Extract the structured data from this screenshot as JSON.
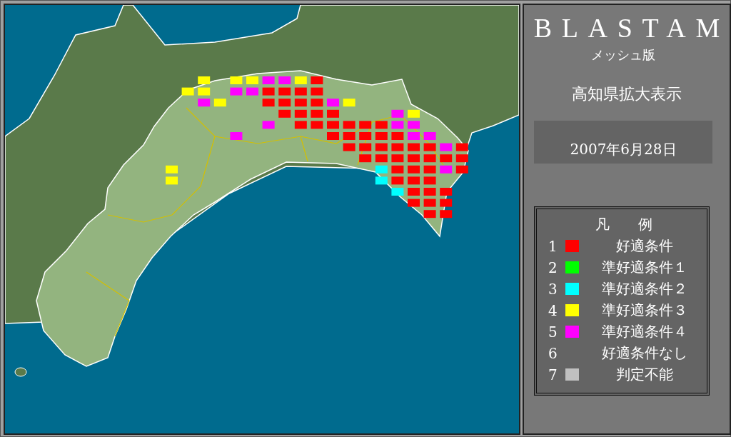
{
  "map": {
    "mesh_rows": [
      {
        "cells": [
          {
            "kind": "blank"
          },
          {
            "kind": "blank"
          },
          {
            "kind": "mesh",
            "color": "#ffff00"
          },
          {
            "kind": "blank"
          },
          {
            "kind": "mesh",
            "color": "#ffff00"
          },
          {
            "kind": "mesh",
            "color": "#ffff00"
          },
          {
            "kind": "mesh",
            "color": "#ff00ff"
          },
          {
            "kind": "mesh",
            "color": "#ff00ff"
          },
          {
            "kind": "mesh",
            "color": "#ffff00"
          },
          {
            "kind": "mesh",
            "color": "#ff0000"
          }
        ]
      },
      {
        "cells": [
          {
            "kind": "blank"
          },
          {
            "kind": "mesh",
            "color": "#ffff00"
          },
          {
            "kind": "mesh",
            "color": "#ffff00"
          },
          {
            "kind": "blank"
          },
          {
            "kind": "mesh",
            "color": "#ff00ff"
          },
          {
            "kind": "mesh",
            "color": "#ff00ff"
          },
          {
            "kind": "mesh",
            "color": "#ff0000"
          },
          {
            "kind": "mesh",
            "color": "#ff0000"
          },
          {
            "kind": "mesh",
            "color": "#ff0000"
          },
          {
            "kind": "mesh",
            "color": "#ff0000"
          }
        ]
      },
      {
        "cells": [
          {
            "kind": "blank"
          },
          {
            "kind": "blank"
          },
          {
            "kind": "mesh",
            "color": "#ff00ff"
          },
          {
            "kind": "mesh",
            "color": "#ffff00"
          },
          {
            "kind": "blank"
          },
          {
            "kind": "blank"
          },
          {
            "kind": "mesh",
            "color": "#ff0000"
          },
          {
            "kind": "mesh",
            "color": "#ff0000"
          },
          {
            "kind": "mesh",
            "color": "#ff0000"
          },
          {
            "kind": "mesh",
            "color": "#ff0000"
          },
          {
            "kind": "mesh",
            "color": "#ff00ff"
          },
          {
            "kind": "mesh",
            "color": "#ffff00"
          }
        ]
      },
      {
        "cells": [
          {
            "kind": "blank"
          },
          {
            "kind": "blank"
          },
          {
            "kind": "blank"
          },
          {
            "kind": "blank"
          },
          {
            "kind": "blank"
          },
          {
            "kind": "blank"
          },
          {
            "kind": "blank"
          },
          {
            "kind": "mesh",
            "color": "#ff0000"
          },
          {
            "kind": "mesh",
            "color": "#ff0000"
          },
          {
            "kind": "mesh",
            "color": "#ff0000"
          },
          {
            "kind": "mesh",
            "color": "#ff0000"
          },
          {
            "kind": "blank"
          },
          {
            "kind": "blank"
          },
          {
            "kind": "blank"
          },
          {
            "kind": "mesh",
            "color": "#ff00ff"
          },
          {
            "kind": "mesh",
            "color": "#ffff00"
          }
        ]
      },
      {
        "cells": [
          {
            "kind": "blank"
          },
          {
            "kind": "blank"
          },
          {
            "kind": "blank"
          },
          {
            "kind": "blank"
          },
          {
            "kind": "blank"
          },
          {
            "kind": "blank"
          },
          {
            "kind": "mesh",
            "color": "#ff00ff"
          },
          {
            "kind": "blank"
          },
          {
            "kind": "mesh",
            "color": "#ff0000"
          },
          {
            "kind": "mesh",
            "color": "#ff0000"
          },
          {
            "kind": "mesh",
            "color": "#ff0000"
          },
          {
            "kind": "mesh",
            "color": "#ff0000"
          },
          {
            "kind": "mesh",
            "color": "#ff0000"
          },
          {
            "kind": "mesh",
            "color": "#ff0000"
          },
          {
            "kind": "mesh",
            "color": "#ff00ff"
          },
          {
            "kind": "mesh",
            "color": "#ff00ff"
          }
        ]
      },
      {
        "cells": [
          {
            "kind": "blank"
          },
          {
            "kind": "blank"
          },
          {
            "kind": "blank"
          },
          {
            "kind": "blank"
          },
          {
            "kind": "mesh",
            "color": "#ff00ff"
          },
          {
            "kind": "blank"
          },
          {
            "kind": "blank"
          },
          {
            "kind": "blank"
          },
          {
            "kind": "blank"
          },
          {
            "kind": "blank"
          },
          {
            "kind": "mesh",
            "color": "#ff0000"
          },
          {
            "kind": "mesh",
            "color": "#ff0000"
          },
          {
            "kind": "mesh",
            "color": "#ff0000"
          },
          {
            "kind": "mesh",
            "color": "#ff0000"
          },
          {
            "kind": "mesh",
            "color": "#ff0000"
          },
          {
            "kind": "mesh",
            "color": "#ff00ff"
          },
          {
            "kind": "mesh",
            "color": "#ff00ff"
          }
        ]
      },
      {
        "cells": [
          {
            "kind": "blank"
          },
          {
            "kind": "blank"
          },
          {
            "kind": "blank"
          },
          {
            "kind": "blank"
          },
          {
            "kind": "blank"
          },
          {
            "kind": "blank"
          },
          {
            "kind": "blank"
          },
          {
            "kind": "blank"
          },
          {
            "kind": "blank"
          },
          {
            "kind": "blank"
          },
          {
            "kind": "blank"
          },
          {
            "kind": "mesh",
            "color": "#ff0000"
          },
          {
            "kind": "mesh",
            "color": "#ff0000"
          },
          {
            "kind": "mesh",
            "color": "#ff0000"
          },
          {
            "kind": "mesh",
            "color": "#ff0000"
          },
          {
            "kind": "mesh",
            "color": "#ff0000"
          },
          {
            "kind": "mesh",
            "color": "#ff0000"
          },
          {
            "kind": "mesh",
            "color": "#ff00ff"
          },
          {
            "kind": "mesh",
            "color": "#ff0000"
          }
        ]
      },
      {
        "cells": [
          {
            "kind": "blank"
          },
          {
            "kind": "blank"
          },
          {
            "kind": "blank"
          },
          {
            "kind": "blank"
          },
          {
            "kind": "blank"
          },
          {
            "kind": "blank"
          },
          {
            "kind": "blank"
          },
          {
            "kind": "blank"
          },
          {
            "kind": "blank"
          },
          {
            "kind": "blank"
          },
          {
            "kind": "blank"
          },
          {
            "kind": "blank"
          },
          {
            "kind": "mesh",
            "color": "#ff0000"
          },
          {
            "kind": "mesh",
            "color": "#ff0000"
          },
          {
            "kind": "mesh",
            "color": "#ff0000"
          },
          {
            "kind": "mesh",
            "color": "#ff0000"
          },
          {
            "kind": "mesh",
            "color": "#ff0000"
          },
          {
            "kind": "mesh",
            "color": "#ff0000"
          },
          {
            "kind": "mesh",
            "color": "#ff0000"
          }
        ]
      },
      {
        "cells": [
          {
            "kind": "mesh",
            "color": "#ffff00"
          },
          {
            "kind": "blank"
          },
          {
            "kind": "blank"
          },
          {
            "kind": "blank"
          },
          {
            "kind": "blank"
          },
          {
            "kind": "blank"
          },
          {
            "kind": "blank"
          },
          {
            "kind": "blank"
          },
          {
            "kind": "blank"
          },
          {
            "kind": "blank"
          },
          {
            "kind": "blank"
          },
          {
            "kind": "blank"
          },
          {
            "kind": "blank"
          },
          {
            "kind": "mesh",
            "color": "#00ffff"
          },
          {
            "kind": "mesh",
            "color": "#ff0000"
          },
          {
            "kind": "mesh",
            "color": "#ff0000"
          },
          {
            "kind": "mesh",
            "color": "#ff0000"
          },
          {
            "kind": "mesh",
            "color": "#ff00ff"
          },
          {
            "kind": "mesh",
            "color": "#ff0000"
          }
        ]
      },
      {
        "cells": [
          {
            "kind": "mesh",
            "color": "#ffff00"
          },
          {
            "kind": "blank"
          },
          {
            "kind": "blank"
          },
          {
            "kind": "blank"
          },
          {
            "kind": "blank"
          },
          {
            "kind": "blank"
          },
          {
            "kind": "blank"
          },
          {
            "kind": "blank"
          },
          {
            "kind": "blank"
          },
          {
            "kind": "blank"
          },
          {
            "kind": "blank"
          },
          {
            "kind": "blank"
          },
          {
            "kind": "blank"
          },
          {
            "kind": "mesh",
            "color": "#00ffff"
          },
          {
            "kind": "mesh",
            "color": "#ff0000"
          },
          {
            "kind": "mesh",
            "color": "#ff0000"
          },
          {
            "kind": "mesh",
            "color": "#ff0000"
          }
        ]
      },
      {
        "cells": [
          {
            "kind": "blank"
          },
          {
            "kind": "blank"
          },
          {
            "kind": "blank"
          },
          {
            "kind": "blank"
          },
          {
            "kind": "blank"
          },
          {
            "kind": "blank"
          },
          {
            "kind": "blank"
          },
          {
            "kind": "blank"
          },
          {
            "kind": "blank"
          },
          {
            "kind": "blank"
          },
          {
            "kind": "blank"
          },
          {
            "kind": "blank"
          },
          {
            "kind": "blank"
          },
          {
            "kind": "blank"
          },
          {
            "kind": "mesh",
            "color": "#00ffff"
          },
          {
            "kind": "mesh",
            "color": "#ff0000"
          },
          {
            "kind": "mesh",
            "color": "#ff0000"
          },
          {
            "kind": "mesh",
            "color": "#ff0000"
          }
        ]
      },
      {
        "cells": [
          {
            "kind": "blank"
          },
          {
            "kind": "blank"
          },
          {
            "kind": "blank"
          },
          {
            "kind": "blank"
          },
          {
            "kind": "blank"
          },
          {
            "kind": "blank"
          },
          {
            "kind": "blank"
          },
          {
            "kind": "blank"
          },
          {
            "kind": "blank"
          },
          {
            "kind": "blank"
          },
          {
            "kind": "blank"
          },
          {
            "kind": "blank"
          },
          {
            "kind": "blank"
          },
          {
            "kind": "blank"
          },
          {
            "kind": "blank"
          },
          {
            "kind": "mesh",
            "color": "#ff0000"
          },
          {
            "kind": "mesh",
            "color": "#ff0000"
          },
          {
            "kind": "mesh",
            "color": "#ff0000"
          }
        ]
      },
      {
        "cells": [
          {
            "kind": "blank"
          },
          {
            "kind": "blank"
          },
          {
            "kind": "blank"
          },
          {
            "kind": "blank"
          },
          {
            "kind": "blank"
          },
          {
            "kind": "blank"
          },
          {
            "kind": "blank"
          },
          {
            "kind": "blank"
          },
          {
            "kind": "blank"
          },
          {
            "kind": "blank"
          },
          {
            "kind": "blank"
          },
          {
            "kind": "blank"
          },
          {
            "kind": "blank"
          },
          {
            "kind": "blank"
          },
          {
            "kind": "blank"
          },
          {
            "kind": "blank"
          },
          {
            "kind": "mesh",
            "color": "#ff0000"
          },
          {
            "kind": "mesh",
            "color": "#ff0000"
          }
        ]
      }
    ]
  },
  "panel": {
    "title": "BLASTAM",
    "subtitle": "メッシュ版",
    "view": "高知県拡大表示",
    "date": "2007年6月28日"
  },
  "legend": {
    "title": "凡　　例",
    "items": [
      {
        "number": "1",
        "color": "#ff0000",
        "label": "好適条件"
      },
      {
        "number": "2",
        "color": "#00ff00",
        "label": "準好適条件１"
      },
      {
        "number": "3",
        "color": "#00ffff",
        "label": "準好適条件２"
      },
      {
        "number": "4",
        "color": "#ffff00",
        "label": "準好適条件３"
      },
      {
        "number": "5",
        "color": "#ff00ff",
        "label": "準好適条件４"
      },
      {
        "number": "6",
        "label": "好適条件なし"
      },
      {
        "number": "7",
        "color": "#c0c0c0",
        "label": "判定不能"
      }
    ]
  }
}
